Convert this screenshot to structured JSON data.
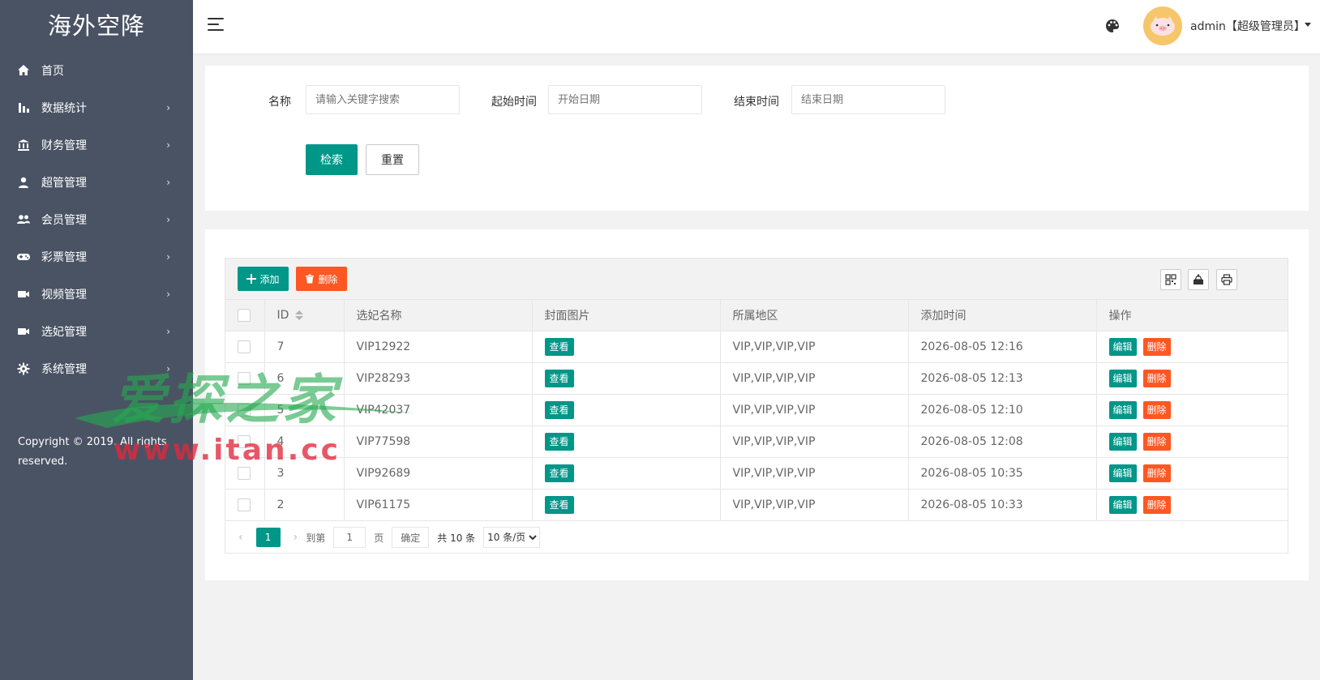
{
  "app": {
    "logo_text": "海外空降"
  },
  "sidebar": {
    "items": [
      {
        "label": "首页",
        "icon": "home-icon",
        "has_arrow": false
      },
      {
        "label": "数据统计",
        "icon": "bar-chart-icon",
        "has_arrow": true
      },
      {
        "label": "财务管理",
        "icon": "bank-icon",
        "has_arrow": true
      },
      {
        "label": "超管管理",
        "icon": "user-icon",
        "has_arrow": true
      },
      {
        "label": "会员管理",
        "icon": "users-icon",
        "has_arrow": true
      },
      {
        "label": "彩票管理",
        "icon": "gamepad-icon",
        "has_arrow": true
      },
      {
        "label": "视频管理",
        "icon": "video-icon",
        "has_arrow": true
      },
      {
        "label": "选妃管理",
        "icon": "video-icon",
        "has_arrow": true
      },
      {
        "label": "系统管理",
        "icon": "gear-icon",
        "has_arrow": true
      }
    ],
    "arrow": "›",
    "copyright": "Copyright © 2019. All rights reserved."
  },
  "header": {
    "user_label": "admin【超级管理员】"
  },
  "search": {
    "name_label": "名称",
    "name_placeholder": "请输入关键字搜索",
    "start_label": "起始时间",
    "start_placeholder": "开始日期",
    "end_label": "结束时间",
    "end_placeholder": "结束日期",
    "search_button": "检索",
    "reset_button": "重置"
  },
  "toolbar": {
    "add_label": "添加",
    "delete_label": "删除"
  },
  "table": {
    "columns": [
      "ID",
      "选妃名称",
      "封面图片",
      "所属地区",
      "添加时间",
      "操作"
    ],
    "rows": [
      {
        "id": "7",
        "name": "VIP12922",
        "cover": "查看",
        "region": "VIP,VIP,VIP,VIP",
        "time": "2026-08-05 12:16",
        "edit": "编辑",
        "delete": "删除"
      },
      {
        "id": "6",
        "name": "VIP28293",
        "cover": "查看",
        "region": "VIP,VIP,VIP,VIP",
        "time": "2026-08-05 12:13",
        "edit": "编辑",
        "delete": "删除"
      },
      {
        "id": "5",
        "name": "VIP42037",
        "cover": "查看",
        "region": "VIP,VIP,VIP,VIP",
        "time": "2026-08-05 12:10",
        "edit": "编辑",
        "delete": "删除"
      },
      {
        "id": "4",
        "name": "VIP77598",
        "cover": "查看",
        "region": "VIP,VIP,VIP,VIP",
        "time": "2026-08-05 12:08",
        "edit": "编辑",
        "delete": "删除"
      },
      {
        "id": "3",
        "name": "VIP92689",
        "cover": "查看",
        "region": "VIP,VIP,VIP,VIP",
        "time": "2026-08-05 10:35",
        "edit": "编辑",
        "delete": "删除"
      },
      {
        "id": "2",
        "name": "VIP61175",
        "cover": "查看",
        "region": "VIP,VIP,VIP,VIP",
        "time": "2026-08-05 10:33",
        "edit": "编辑",
        "delete": "删除"
      }
    ]
  },
  "pager": {
    "current": "1",
    "goto_label": "到第",
    "goto_value": "1",
    "page_unit": "页",
    "confirm": "确定",
    "total": "共 10 条",
    "limit": "10 条/页"
  },
  "watermark": {
    "cn": "爱探之家",
    "url": "www.itan.cc"
  },
  "colors": {
    "primary": "#009688",
    "danger": "#ff5722",
    "sidebar_bg": "#4a5364"
  }
}
